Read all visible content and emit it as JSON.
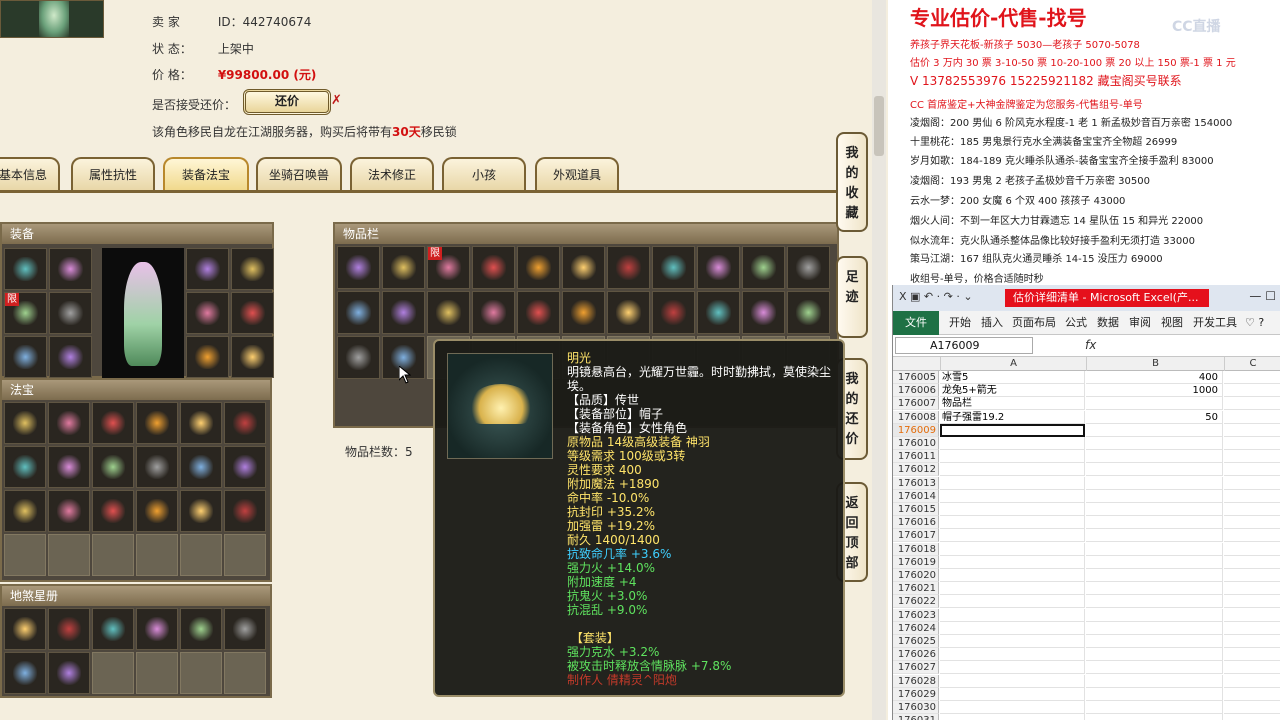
{
  "seller": {
    "id_label": "卖  家",
    "id_prefix": "ID：",
    "id_value": "442740674",
    "status_label": "状      态：",
    "status_value": "上架中",
    "price_label": "价      格：",
    "price_value": "¥99800.00 (元)",
    "bargain_label": "是否接受还价：",
    "bargain_button": "还价",
    "bargain_mark": "✗",
    "note_before": "该角色移民自龙在江湖服务器，购买后将带有",
    "note_highlight": "30天",
    "note_after": "移民锁"
  },
  "tabs": [
    {
      "label": "基本信息"
    },
    {
      "label": "属性抗性"
    },
    {
      "label": "装备法宝"
    },
    {
      "label": "坐骑召唤兽"
    },
    {
      "label": "法术修正"
    },
    {
      "label": "小孩"
    },
    {
      "label": "外观道具"
    }
  ],
  "panels": {
    "equipment": "装备",
    "treasure": "法宝",
    "star_book": "地煞星册",
    "bag": "物品栏",
    "bag_count": "物品栏数：5",
    "limited": "限"
  },
  "side_buttons": [
    {
      "label": "我的收藏"
    },
    {
      "label": "足迹"
    },
    {
      "label": "我的还价"
    },
    {
      "label": "返回顶部"
    }
  ],
  "tooltip": {
    "lines": [
      {
        "text": "明光",
        "color": "yellow"
      },
      {
        "text": "明镜悬高台，光耀万世霾。时时勤拂拭，莫使染尘埃。",
        "color": "white"
      },
      {
        "text": "【品质】传世",
        "color": "white"
      },
      {
        "text": "【装备部位】帽子",
        "color": "white"
      },
      {
        "text": "【装备角色】女性角色",
        "color": "white"
      },
      {
        "text": "原物品 14级高级装备 神羽",
        "color": "yellow"
      },
      {
        "text": "等级需求 100级或3转",
        "color": "yellow"
      },
      {
        "text": "灵性要求 400",
        "color": "yellow"
      },
      {
        "text": "附加魔法 +1890",
        "color": "yellow"
      },
      {
        "text": "命中率 -10.0%",
        "color": "yellow"
      },
      {
        "text": "抗封印 +35.2%",
        "color": "yellow"
      },
      {
        "text": "加强雷 +19.2%",
        "color": "yellow"
      },
      {
        "text": "耐久 1400/1400",
        "color": "yellow"
      },
      {
        "text": "抗致命几率 +3.6%",
        "color": "cyan"
      },
      {
        "text": "强力火 +14.0%",
        "color": "green"
      },
      {
        "text": "附加速度 +4",
        "color": "green"
      },
      {
        "text": "抗鬼火 +3.0%",
        "color": "green"
      },
      {
        "text": "抗混乱 +9.0%",
        "color": "green"
      },
      {
        "text": " ",
        "color": "white"
      },
      {
        "text": " 【套装】",
        "color": "yellow"
      },
      {
        "text": "强力克水 +3.2%",
        "color": "green"
      },
      {
        "text": "被攻击时释放含情脉脉 +7.8%",
        "color": "green"
      },
      {
        "text": "制作人 倩精灵^阳炮",
        "color": "red"
      }
    ]
  },
  "ad": {
    "title": "专业估价-代售-找号",
    "logo": "CC直播",
    "lines": [
      {
        "text": "养孩子界天花板-新孩子 5030—老孩子 5070-5078",
        "style": "red"
      },
      {
        "text": "估价 3 万内 30 票  3-10-50 票  10-20-100 票  20 以上 150 票-1 票 1 元",
        "style": "red"
      },
      {
        "text": "V 13782553976    15225921182   藏宝阁买号联系",
        "style": "redbig"
      },
      {
        "text": "CC 首席鉴定+大神金牌鉴定为您服务-代售组号-单号",
        "style": "red"
      },
      {
        "text": "凌烟阁：200 男仙 6 阶风克水程度-1 老 1 新孟极妙音百万亲密 154000",
        "style": "dark"
      },
      {
        "text": "十里桃花：185 男鬼景行克水全满装备宝宝齐全物超 26999",
        "style": "dark"
      },
      {
        "text": "岁月如歌：184-189 克火睡杀队通杀-装备宝宝齐全接手盈利 83000",
        "style": "dark"
      },
      {
        "text": "凌烟阁：193 男鬼 2 老孩子孟极妙音千万亲密 30500",
        "style": "dark"
      },
      {
        "text": "云水一梦：200 女魔 6 个双 400 孩孩子 43000",
        "style": "dark"
      },
      {
        "text": "烟火人间：不到一年区大力甘霖遗忘 14 星队伍 15 和异光 22000",
        "style": "dark"
      },
      {
        "text": "似水流年：克火队通杀整体品像比较好接手盈利无须打造 33000",
        "style": "dark"
      },
      {
        "text": "策马江湖：167 组队克火通灵睡杀 14-15 没压力 69000",
        "style": "dark"
      },
      {
        "text": "收组号-单号，价格合适随时秒",
        "style": "dark"
      }
    ]
  },
  "excel": {
    "quick_access": "X ▣ ↶ · ↷ · ⌄",
    "title": "估价详细清单 - Microsoft Excel(产...",
    "window_buttons": "—   ☐",
    "file_tab": "文件",
    "ribbon_tabs": [
      "开始",
      "插入",
      "页面布局",
      "公式",
      "数据",
      "审阅",
      "视图",
      "开发工具"
    ],
    "ribbon_extra": "♡  ?",
    "namebox": "A176009",
    "fx": "fx",
    "columns": [
      "A",
      "B",
      "C"
    ],
    "rows": [
      {
        "num": "176005",
        "a": "冰雪5",
        "b": "400"
      },
      {
        "num": "176006",
        "a": "龙兔5+箭无",
        "b": "1000"
      },
      {
        "num": "176007",
        "a": "物品栏",
        "b": ""
      },
      {
        "num": "176008",
        "a": "帽子强雷19.2",
        "b": "50"
      },
      {
        "num": "176009",
        "a": "",
        "b": ""
      },
      {
        "num": "176010",
        "a": "",
        "b": ""
      },
      {
        "num": "176011",
        "a": "",
        "b": ""
      },
      {
        "num": "176012",
        "a": "",
        "b": ""
      },
      {
        "num": "176013",
        "a": "",
        "b": ""
      },
      {
        "num": "176014",
        "a": "",
        "b": ""
      },
      {
        "num": "176015",
        "a": "",
        "b": ""
      },
      {
        "num": "176016",
        "a": "",
        "b": ""
      },
      {
        "num": "176017",
        "a": "",
        "b": ""
      },
      {
        "num": "176018",
        "a": "",
        "b": ""
      },
      {
        "num": "176019",
        "a": "",
        "b": ""
      },
      {
        "num": "176020",
        "a": "",
        "b": ""
      },
      {
        "num": "176021",
        "a": "",
        "b": ""
      },
      {
        "num": "176022",
        "a": "",
        "b": ""
      },
      {
        "num": "176023",
        "a": "",
        "b": ""
      },
      {
        "num": "176024",
        "a": "",
        "b": ""
      },
      {
        "num": "176025",
        "a": "",
        "b": ""
      },
      {
        "num": "176026",
        "a": "",
        "b": ""
      },
      {
        "num": "176027",
        "a": "",
        "b": ""
      },
      {
        "num": "176028",
        "a": "",
        "b": ""
      },
      {
        "num": "176029",
        "a": "",
        "b": ""
      },
      {
        "num": "176030",
        "a": "",
        "b": ""
      },
      {
        "num": "176031",
        "a": "",
        "b": ""
      }
    ],
    "active_row": "176009"
  },
  "colors": {
    "price_red": "#d21010",
    "excel_green": "#1e7145",
    "ad_red": "#e0141b"
  }
}
